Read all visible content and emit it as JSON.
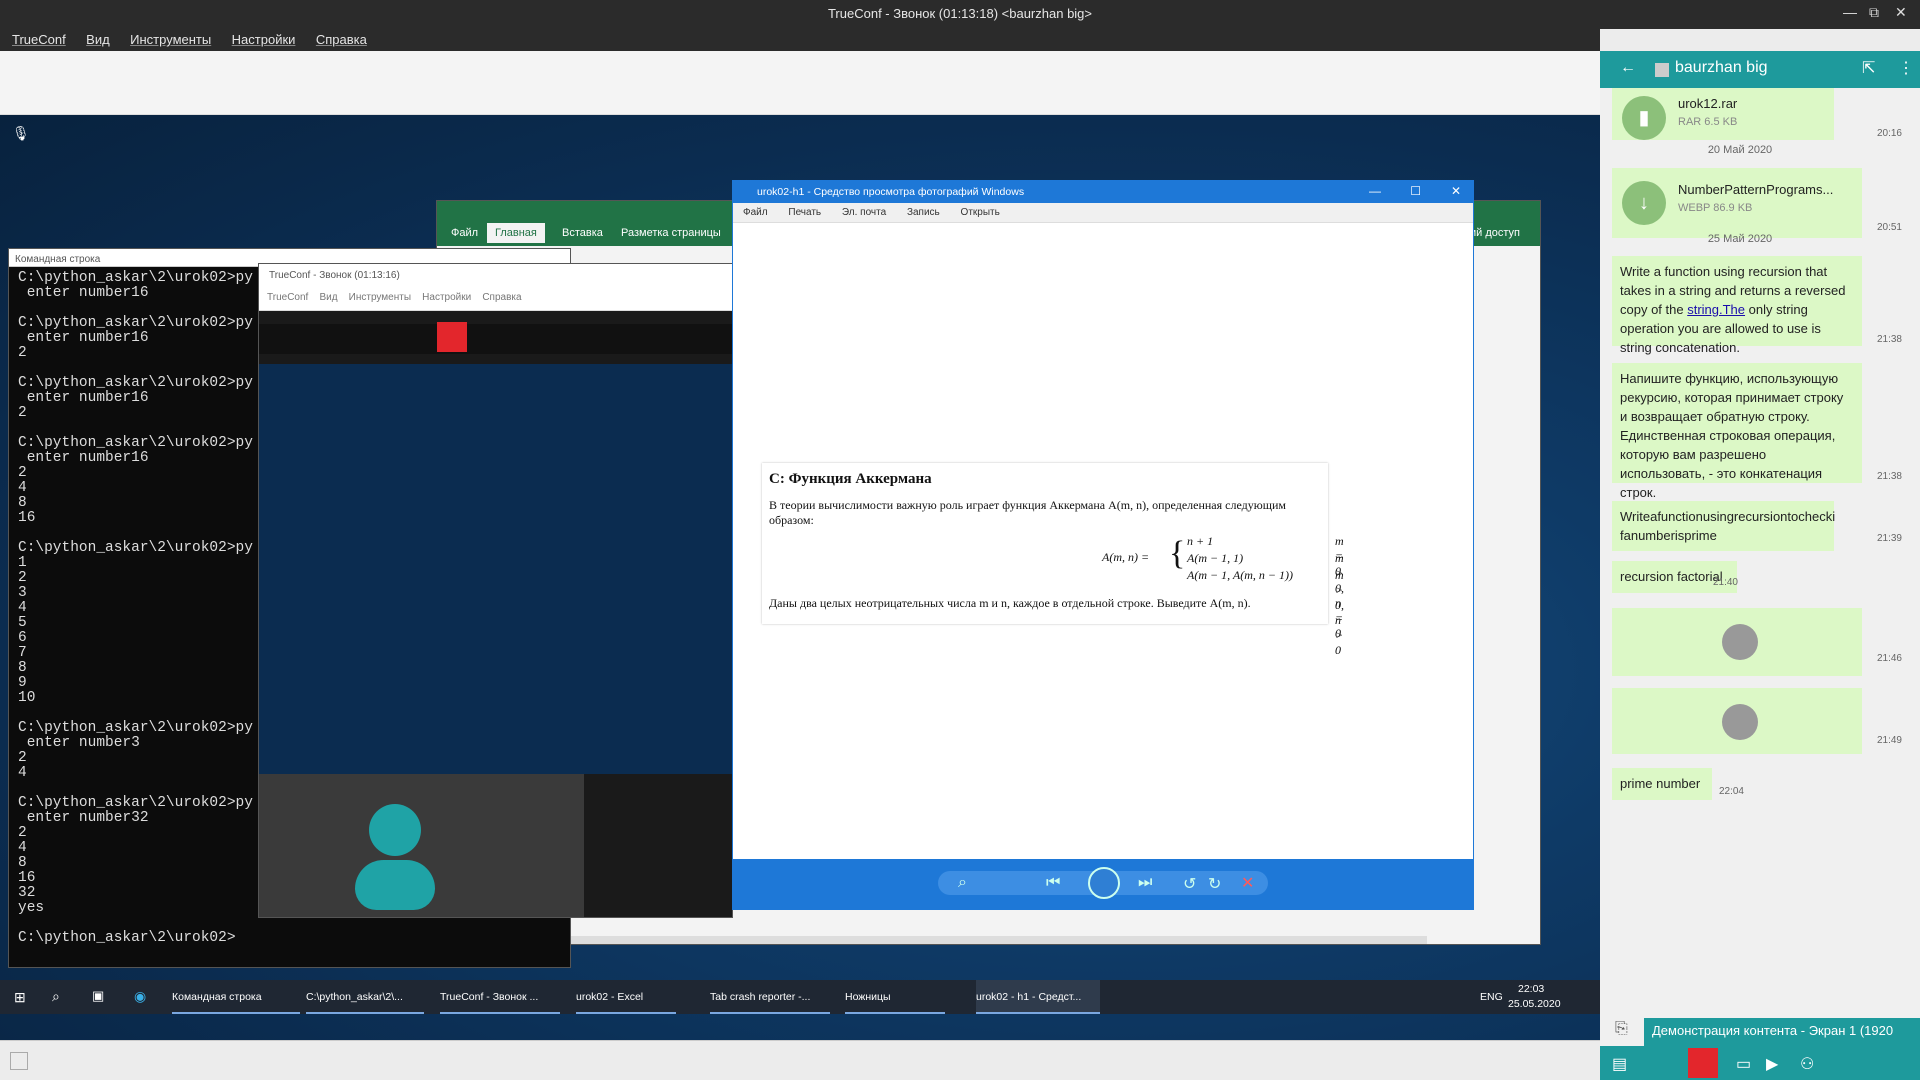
{
  "window": {
    "title": "TrueConf - Звонок (01:13:18) <baurzhan big>"
  },
  "menubar": [
    "TrueConf",
    "Вид",
    "Инструменты",
    "Настройки",
    "Справка"
  ],
  "cmd": {
    "title": "Командная строка",
    "lines": "C:\\python_askar\\2\\urok02>py\n enter number16\n\nC:\\python_askar\\2\\urok02>py\n enter number16\n2\n\nC:\\python_askar\\2\\urok02>py\n enter number16\n2\n\nC:\\python_askar\\2\\urok02>py\n enter number16\n2\n4\n8\n16\n\nC:\\python_askar\\2\\urok02>py\n1\n2\n3\n4\n5\n6\n7\n8\n9\n10\n\nC:\\python_askar\\2\\urok02>py\n enter number3\n2\n4\n\nC:\\python_askar\\2\\urok02>py\n enter number32\n2\n4\n8\n16\n32\nyes\n\nC:\\python_askar\\2\\urok02>"
  },
  "inner_trueconf": {
    "title": "TrueConf - Звонок (01:13:16)",
    "menu": [
      "TrueConf",
      "Вид",
      "Инструменты",
      "Настройки",
      "Справка"
    ]
  },
  "excel": {
    "tabs": [
      "Файл",
      "Главная",
      "Вставка",
      "Разметка страницы"
    ],
    "right_label": "щий доступ"
  },
  "photo_viewer": {
    "title": "urok02-h1 - Средство просмотра фотографий Windows",
    "menu": [
      "Файл",
      "Печать",
      "Эл. почта",
      "Запись",
      "Открыть"
    ],
    "doc_heading": "C: Функция Аккермана",
    "doc_para1": "В теории вычислимости важную роль играет функция Аккермана A(m, n), определенная следующим образом:",
    "formula_lhs": "A(m, n) =",
    "formula_rows": [
      {
        "expr": "n + 1",
        "cond": "m = 0"
      },
      {
        "expr": "A(m − 1, 1)",
        "cond": "m > 0, n = 0"
      },
      {
        "expr": "A(m − 1, A(m, n − 1))",
        "cond": "m > 0, n > 0"
      }
    ],
    "doc_para2": "Даны два целых неотрицательных числа m и n, каждое в отдельной строке. Выведите A(m, n)."
  },
  "taskbar": {
    "items": [
      "Командная строка",
      "C:\\python_askar\\2\\...",
      "TrueConf - Звонок ...",
      "urok02 - Excel",
      "Tab crash reporter -...",
      "Ножницы",
      "urok02 - h1 - Средст..."
    ],
    "lang": "ENG",
    "time": "22:03",
    "date": "25.05.2020"
  },
  "chat": {
    "contact": "baurzhan big",
    "files": [
      {
        "name": "urok12.rar",
        "meta": "RAR  6.5 KB",
        "time": "20:16"
      },
      {
        "name": "NumberPatternPrograms...",
        "meta": "WEBP  86.9 KB",
        "time": "20:51"
      }
    ],
    "days": [
      "20 Май 2020",
      "25 Май 2020"
    ],
    "messages": [
      {
        "pre": "Write a function using recursion that takes in a string and returns a reversed copy of the ",
        "link": "string.The",
        "post": " only string operation you are allowed to use is string concatenation.",
        "time": "21:38"
      },
      {
        "text": "Напишите функцию, использующую рекурсию, которая принимает строку и возвращает обратную строку. Единственная строковая операция, которую вам разрешено использовать, - это конкатенация строк.",
        "time": "21:38"
      },
      {
        "text": "Writeafunctionusingrecursiontochecki fanumberisprime",
        "time": "21:39"
      },
      {
        "text": "recursion factorial",
        "time": "21:40"
      },
      {
        "time": "21:46"
      },
      {
        "time": "21:49"
      },
      {
        "text": "prime number",
        "time": "22:04"
      }
    ],
    "share_label": "Демонстрация контента - Экран 1 (1920"
  },
  "colors": {
    "accent": "#1e9a9c",
    "bubble": "#dcf8c6",
    "end_call": "#e3262c",
    "photo_blue": "#1e78d7",
    "excel_green": "#217346"
  }
}
